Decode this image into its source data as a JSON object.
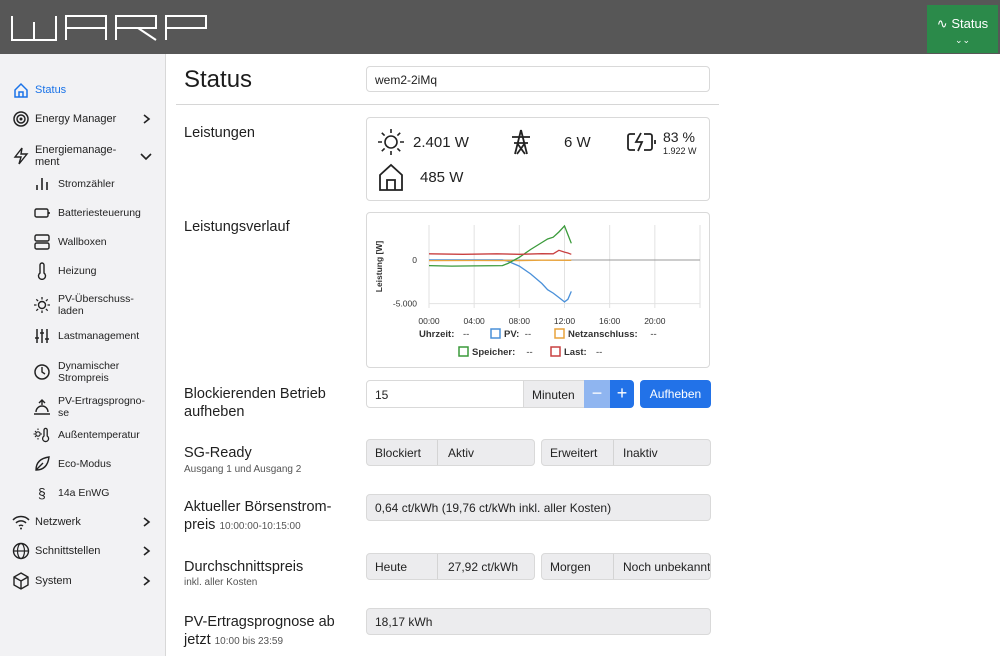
{
  "topbar": {
    "logo": "WARP",
    "status_button": "Status",
    "chevron": "»"
  },
  "sidebar": {
    "items": [
      {
        "label": "Status",
        "icon": "home-icon",
        "active": true
      },
      {
        "label": "Energy Manager",
        "icon": "target-icon",
        "expand": "chevron-right-icon"
      },
      {
        "label": "Energiemanage-\nment",
        "icon": "bolt-icon",
        "expand": "chevron-down-icon"
      },
      {
        "label": "Stromzähler",
        "icon": "bar-chart-icon",
        "sub": true
      },
      {
        "label": "Batteriesteuerung",
        "icon": "battery-icon",
        "sub": true
      },
      {
        "label": "Wallboxen",
        "icon": "server-icon",
        "sub": true
      },
      {
        "label": "Heizung",
        "icon": "thermometer-icon",
        "sub": true
      },
      {
        "label": "PV-Überschuss-\nladen",
        "icon": "sun-icon",
        "sub": true
      },
      {
        "label": "Lastmanagement",
        "icon": "sliders-icon",
        "sub": true
      },
      {
        "label": "Dynamischer\nStrompreis",
        "icon": "clock-euro-icon",
        "sub": true
      },
      {
        "label": "PV-Ertragsprogno-\nse",
        "icon": "sunrise-icon",
        "sub": true
      },
      {
        "label": "Außentemperatur",
        "icon": "sun-thermometer-icon",
        "sub": true
      },
      {
        "label": "Eco-Modus",
        "icon": "leaf-icon",
        "sub": true
      },
      {
        "label": "14a EnWG",
        "icon": "section-icon",
        "sub": true
      },
      {
        "label": "Netzwerk",
        "icon": "wifi-icon",
        "expand": "chevron-right-icon"
      },
      {
        "label": "Schnittstellen",
        "icon": "globe-icon",
        "expand": "chevron-right-icon"
      },
      {
        "label": "System",
        "icon": "box-icon",
        "expand": "chevron-right-icon"
      }
    ]
  },
  "page": {
    "title": "Status",
    "device_name": "wem2-2iMq"
  },
  "leistungen": {
    "label": "Leistungen",
    "pv": "2.401 W",
    "grid": "6 W",
    "battery_soc": "83 %",
    "battery_power": "1.922 W",
    "house": "485 W"
  },
  "verlauf": {
    "label": "Leistungsverlauf"
  },
  "chart_data": {
    "type": "line",
    "ylabel": "Leistung [W]",
    "yticks": [
      "0",
      "-5.000"
    ],
    "xticks": [
      "00:00",
      "04:00",
      "08:00",
      "12:00",
      "16:00",
      "20:00"
    ],
    "xlim": [
      0,
      24
    ],
    "ylim": [
      -5500,
      4000
    ],
    "legend": [
      {
        "name": "Uhrzeit:",
        "value": "--"
      },
      {
        "name": "PV:",
        "value": "--",
        "color": "#4a90d9"
      },
      {
        "name": "Netzanschluss:",
        "value": "--",
        "color": "#e8a33c"
      },
      {
        "name": "Speicher:",
        "value": "--",
        "color": "#3a9a3a"
      },
      {
        "name": "Last:",
        "value": "--",
        "color": "#c94040"
      }
    ],
    "series": [
      {
        "name": "PV",
        "color": "#4a90d9",
        "x": [
          0,
          6.5,
          7,
          8,
          9,
          10,
          10.5,
          11,
          11.5,
          12,
          12.3,
          12.6
        ],
        "y": [
          0,
          0,
          -150,
          -700,
          -1600,
          -2700,
          -3400,
          -3800,
          -4300,
          -4800,
          -4500,
          -3600
        ]
      },
      {
        "name": "Netzanschluss",
        "color": "#e8a33c",
        "x": [
          0,
          4,
          8,
          10,
          12.6
        ],
        "y": [
          -80,
          -60,
          -80,
          -30,
          -40
        ]
      },
      {
        "name": "Speicher",
        "color": "#3a9a3a",
        "x": [
          0,
          2,
          4,
          6.5,
          7,
          8,
          9,
          10,
          10.5,
          11,
          11.5,
          12,
          12.3,
          12.6
        ],
        "y": [
          -650,
          -700,
          -680,
          -650,
          -400,
          300,
          1200,
          2000,
          2400,
          2600,
          3200,
          3900,
          2900,
          1900
        ]
      },
      {
        "name": "Last",
        "color": "#c94040",
        "x": [
          0,
          3,
          6,
          8,
          10,
          11,
          11.5,
          12,
          12.3,
          12.6
        ],
        "y": [
          700,
          650,
          700,
          650,
          720,
          700,
          1100,
          900,
          800,
          650
        ]
      }
    ]
  },
  "blockieren": {
    "label": "Blockierenden Betrieb\naufheben",
    "value": "15",
    "unit": "Minuten",
    "minus": "−",
    "plus": "+",
    "button": "Aufheben"
  },
  "sgready": {
    "label": "SG-Ready",
    "sub": "Ausgang 1 und Ausgang 2",
    "k1": "Blockiert",
    "v1": "Aktiv",
    "k2": "Erweitert",
    "v2": "Inaktiv"
  },
  "boerse": {
    "label": "Aktueller Börsenstrom-\npreis",
    "time": "10:00:00-10:15:00",
    "value": "0,64 ct/kWh (19,76 ct/kWh inkl. aller Kosten)"
  },
  "durchschnitt": {
    "label": "Durchschnittspreis",
    "sub": "inkl. aller Kosten",
    "k1": "Heute",
    "v1": "27,92 ct/kWh",
    "k2": "Morgen",
    "v2": "Noch unbekannt"
  },
  "prognose": {
    "label": "PV-Ertragsprognose ab\njetzt",
    "time": "10:00 bis 23:59",
    "value": "18,17 kWh"
  }
}
